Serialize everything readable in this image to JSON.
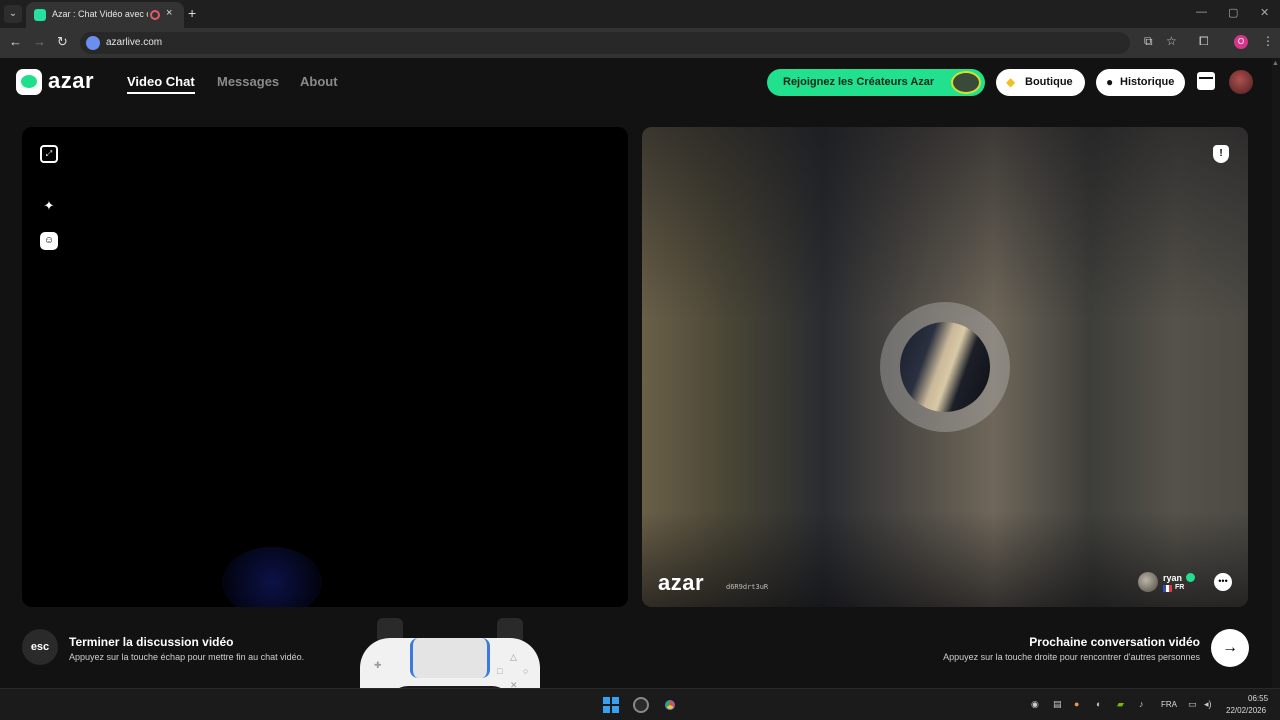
{
  "browser": {
    "tab_title": "Azar : Chat Vidéo avec de n",
    "tab_close": "×",
    "new_tab": "+",
    "url": "azarlive.com",
    "win_min": "—",
    "win_max": "▢",
    "win_close": "✕",
    "profile_initial": "O"
  },
  "header": {
    "logo_text": "azar",
    "nav": [
      "Video Chat",
      "Messages",
      "About"
    ],
    "creators_label": "Rejoignez les Créateurs Azar",
    "shop_label": "Boutique",
    "shop_icon": "gem-icon",
    "history_label": "Historique",
    "history_icon": "clock-icon"
  },
  "partner": {
    "watermark": "azar",
    "session_id": "d6R9drt3uR",
    "name": "ryan",
    "country": "FR",
    "report_icon": "!"
  },
  "controls": {
    "esc_label": "esc",
    "end_title": "Terminer la discussion vidéo",
    "end_hint": "Appuyez sur la touche échap pour mettre fin au chat vidéo.",
    "next_title": "Prochaine conversation vidéo",
    "next_hint": "Appuyez sur la touche droite pour rencontrer d'autres personnes",
    "next_icon": "→"
  },
  "taskbar": {
    "language": "FRA",
    "time": "06:55",
    "date": "22/02/2026"
  },
  "colors": {
    "accent": "#21e08e",
    "background": "#121212"
  }
}
